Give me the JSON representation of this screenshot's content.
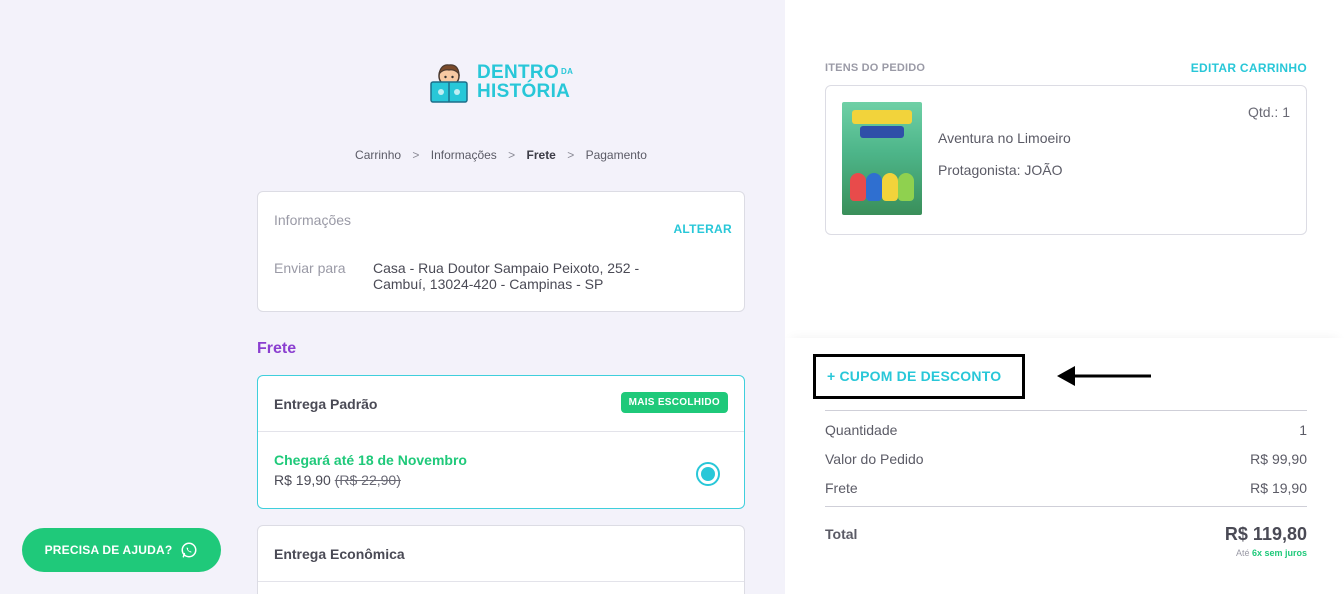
{
  "brand": {
    "line1": "DENTRO",
    "line1_small": "DA",
    "line2": "HISTÓRIA",
    "accent": "#28c7d8"
  },
  "breadcrumb": {
    "items": [
      "Carrinho",
      "Informações",
      "Frete",
      "Pagamento"
    ],
    "separator": ">"
  },
  "info": {
    "label": "Informações",
    "change_label": "ALTERAR",
    "ship_label": "Enviar para",
    "ship_value": "Casa - Rua Doutor Sampaio Peixoto, 252 - Cambuí, 13024-420 - Campinas - SP"
  },
  "shipping": {
    "title": "Frete",
    "options": [
      {
        "name": "Entrega Padrão",
        "badge": "MAIS ESCOLHIDO",
        "arrival": "Chegará até 18 de Novembro",
        "price": "R$ 19,90",
        "old_price": "(R$ 22,90)",
        "selected": true
      },
      {
        "name": "Entrega Econômica"
      }
    ]
  },
  "help": {
    "label": "PRECISA DE AJUDA?",
    "icon": "whatsapp-icon"
  },
  "order": {
    "items_title": "ITENS DO PEDIDO",
    "edit_label": "EDITAR CARRINHO",
    "item": {
      "qty": "Qtd.: 1",
      "name": "Aventura no Limoeiro",
      "protagonist": "Protagonista: JOÃO"
    }
  },
  "summary": {
    "coupon_label": "+ CUPOM DE DESCONTO",
    "rows": [
      {
        "label": "Quantidade",
        "value": "1"
      },
      {
        "label": "Valor do Pedido",
        "value": "R$ 99,90"
      },
      {
        "label": "Frete",
        "value": "R$ 19,90"
      }
    ],
    "total_label": "Total",
    "total_value": "R$ 119,80",
    "installments_prefix": "Até ",
    "installments_value": "6x sem juros"
  },
  "colors": {
    "accent": "#28c7d8",
    "success": "#1fc97a",
    "section": "#8b3fd0"
  }
}
